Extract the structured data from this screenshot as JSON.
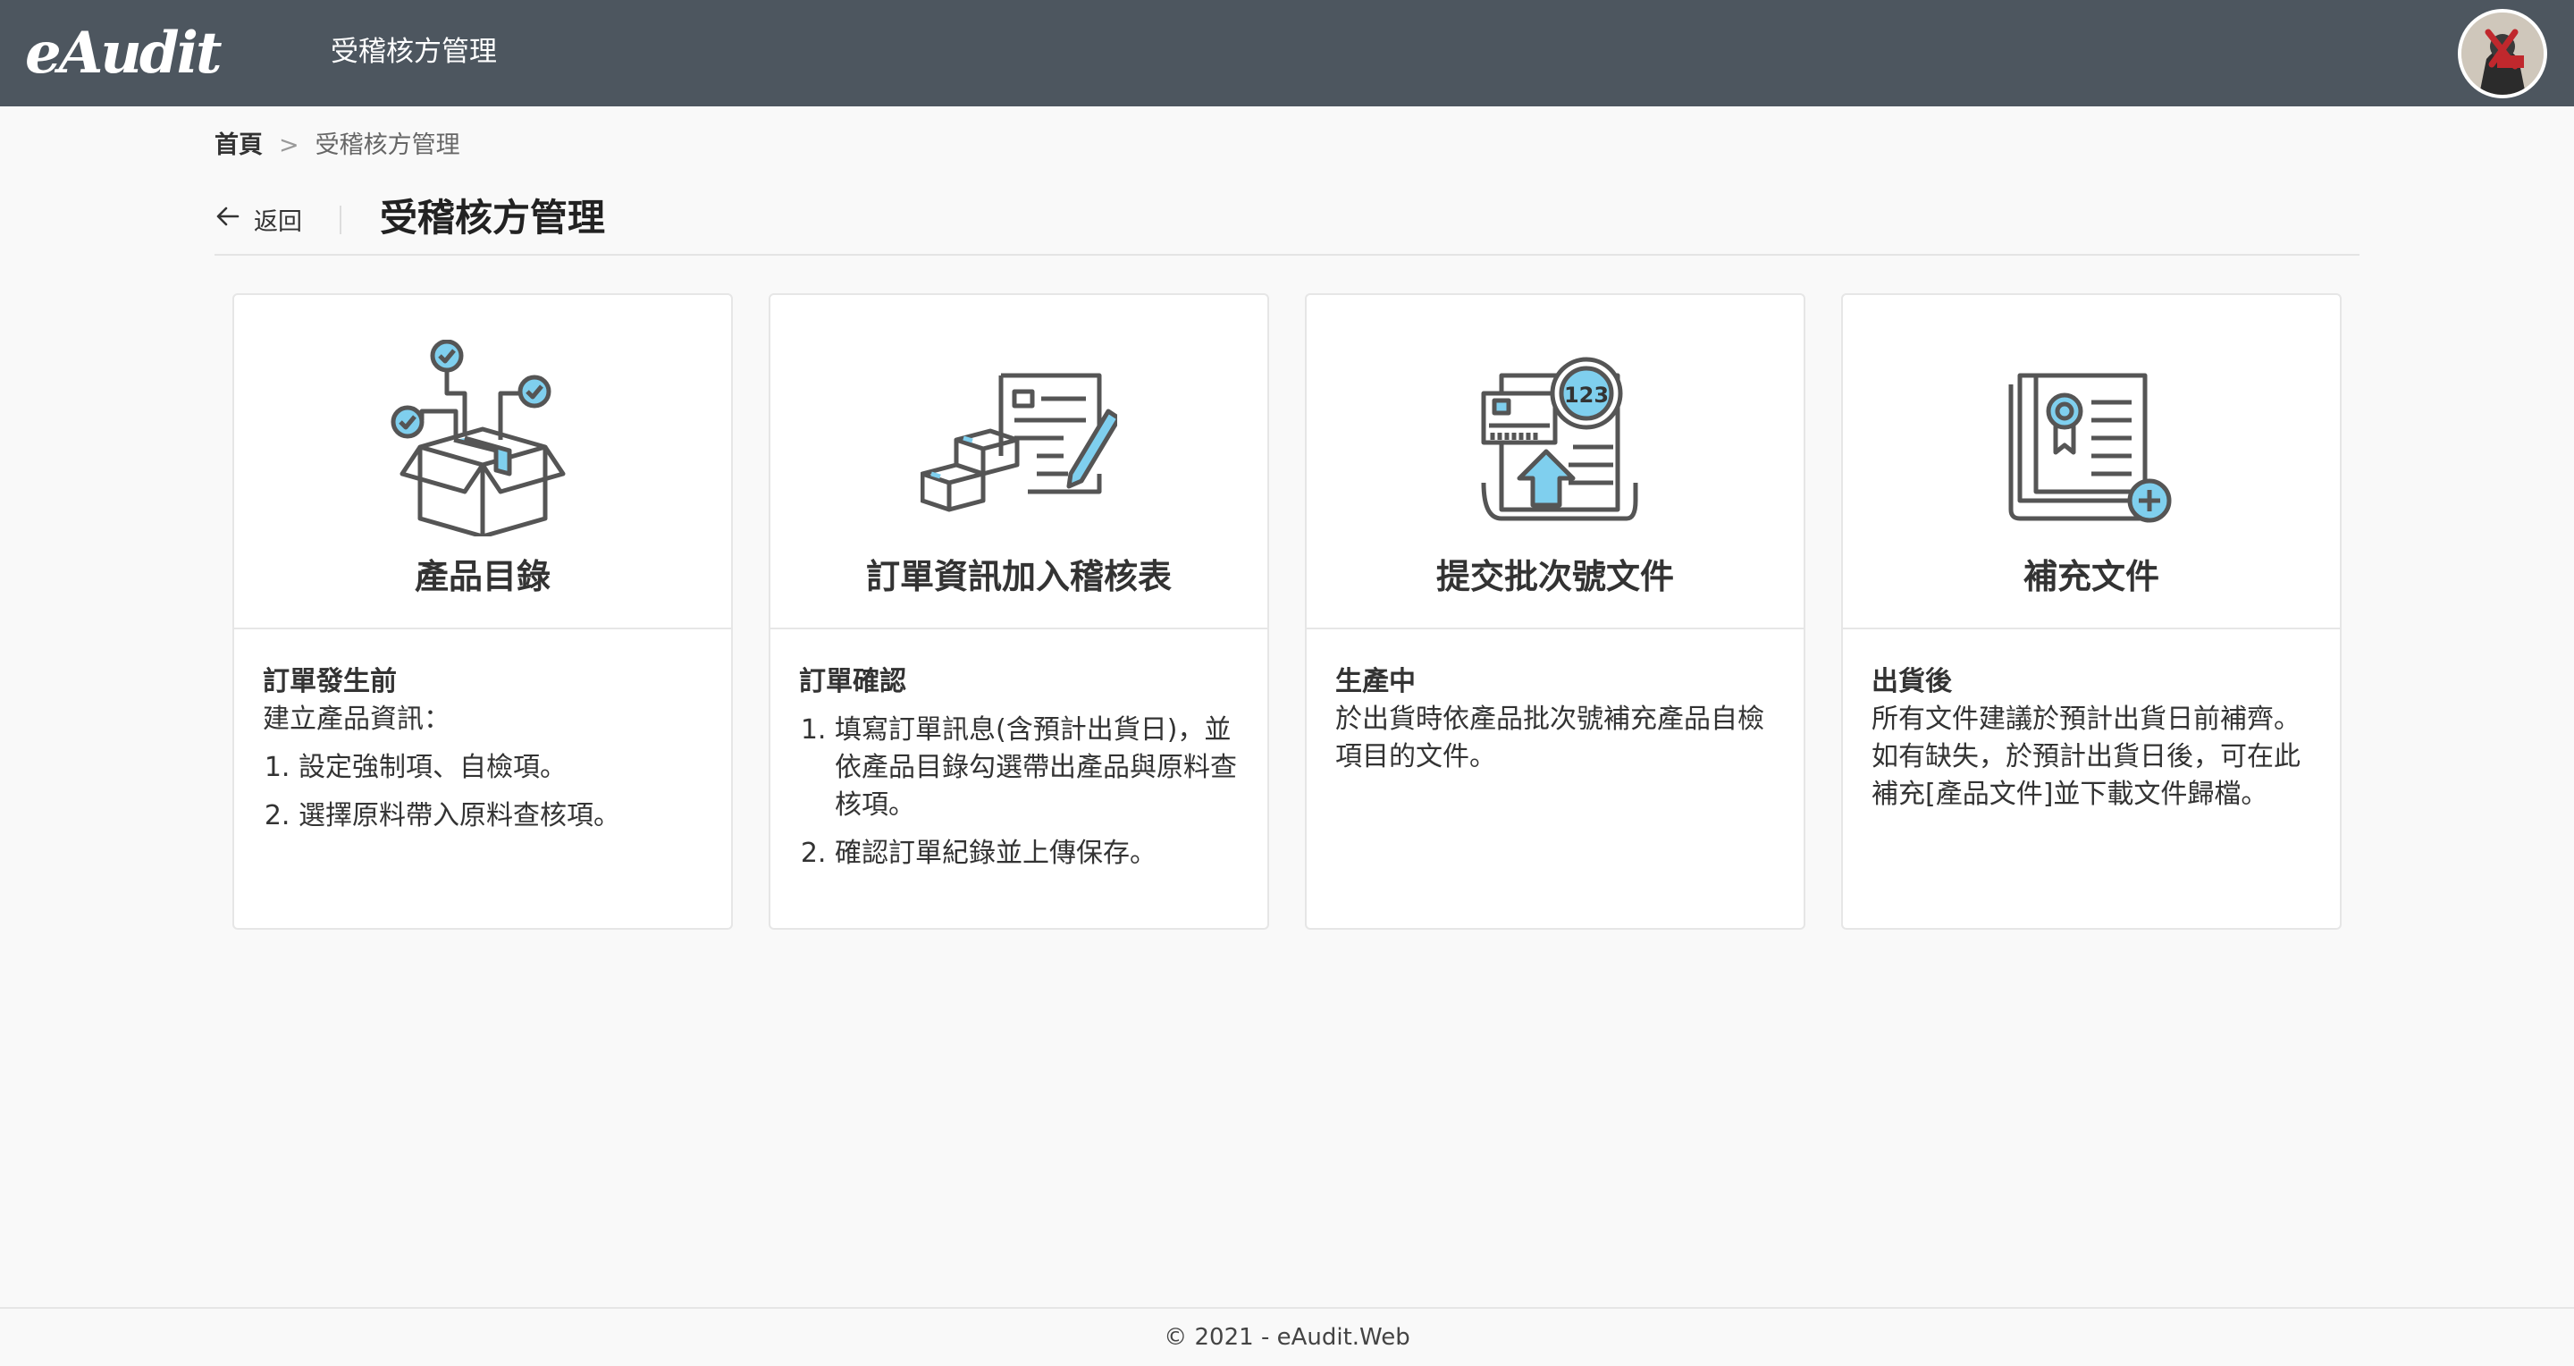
{
  "header": {
    "logo_text": "eAudit",
    "app_title": "受稽核方管理"
  },
  "breadcrumb": {
    "home": "首頁",
    "separator": ">",
    "current": "受稽核方管理"
  },
  "page": {
    "back_label": "返回",
    "title": "受稽核方管理"
  },
  "cards": [
    {
      "icon": "box-checklist-icon",
      "title": "產品目錄",
      "heading": "訂單發生前",
      "intro": "建立產品資訊：",
      "items": [
        "設定強制項、自檢項。",
        "選擇原料帶入原料查核項。"
      ],
      "paragraphs": []
    },
    {
      "icon": "order-form-boxes-icon",
      "title": "訂單資訊加入稽核表",
      "heading": "訂單確認",
      "intro": "",
      "items": [
        "填寫訂單訊息(含預計出貨日)，並依產品目錄勾選帶出產品與原料查核項。",
        "確認訂單紀錄並上傳保存。"
      ],
      "paragraphs": []
    },
    {
      "icon": "batch-upload-document-icon",
      "title": "提交批次號文件",
      "heading": "生產中",
      "intro": "",
      "items": [],
      "paragraphs": [
        "於出貨時依產品批次號補充產品自檢項目的文件。"
      ]
    },
    {
      "icon": "certificate-add-icon",
      "title": "補充文件",
      "heading": "出貨後",
      "intro": "",
      "items": [],
      "paragraphs": [
        "所有文件建議於預計出貨日前補齊。",
        "如有缺失，於預計出貨日後，可在此補充[產品文件]並下載文件歸檔。"
      ]
    }
  ],
  "footer": {
    "text": "© 2021 - eAudit.Web"
  },
  "colors": {
    "topbar": "#4d565f",
    "accent": "#5bc0eb",
    "icon_stroke": "#555555"
  }
}
